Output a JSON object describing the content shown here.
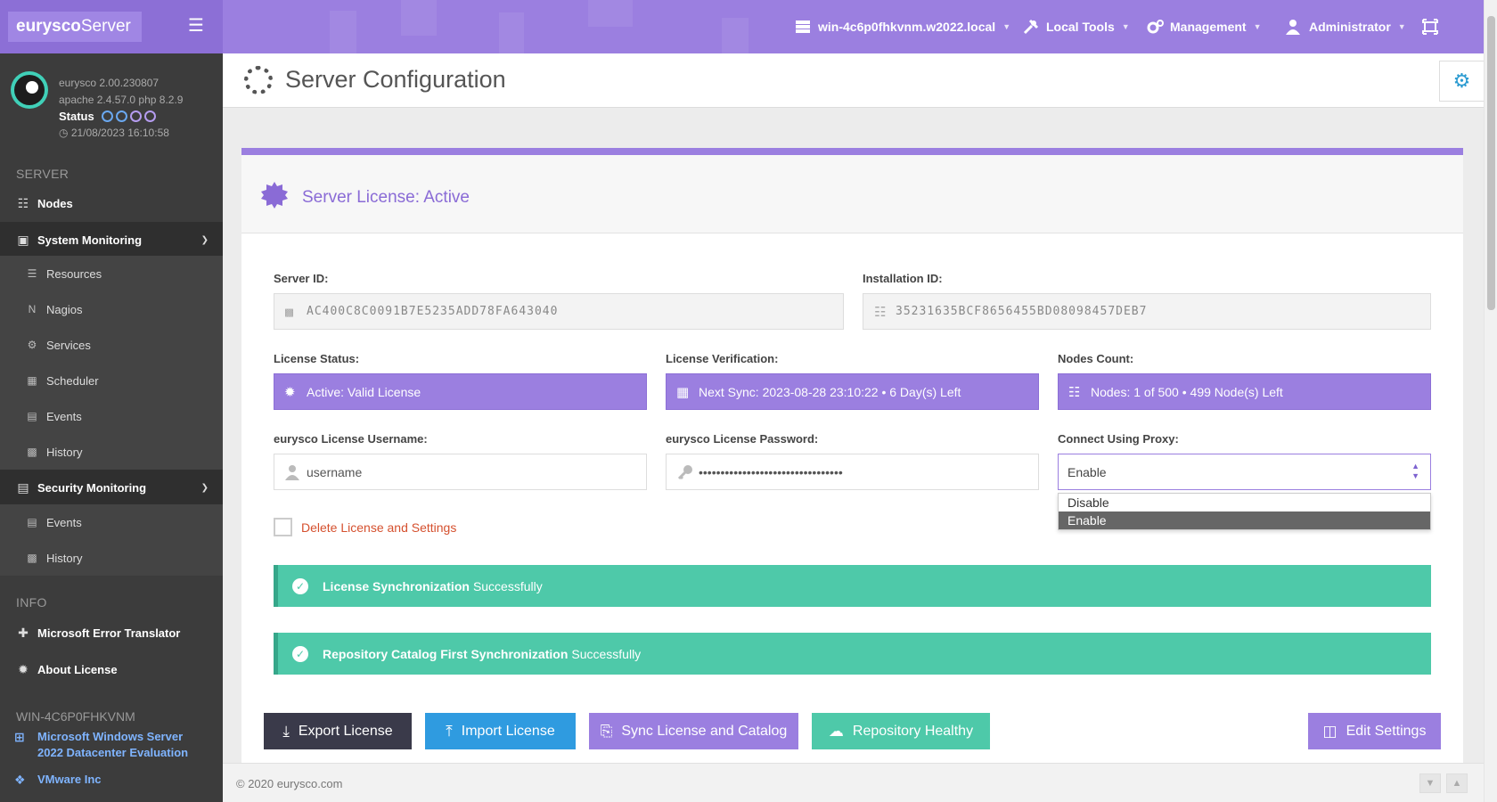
{
  "header": {
    "brand_bold": "eurysco",
    "brand_light": "Server",
    "host": "win-4c6p0fhkvnm.w2022.local",
    "local_tools": "Local Tools",
    "management": "Management",
    "user": "Administrator"
  },
  "sidebar": {
    "version": "eurysco 2.00.230807",
    "stack": "apache 2.4.57.0  php 8.2.9",
    "status_label": "Status",
    "datetime": "21/08/2023 16:10:58",
    "section_server": "SERVER",
    "nodes": "Nodes",
    "system_monitoring": "System Monitoring",
    "sys_items": [
      "Resources",
      "Nagios",
      "Services",
      "Scheduler",
      "Events",
      "History"
    ],
    "security_monitoring": "Security Monitoring",
    "sec_items": [
      "Events",
      "History"
    ],
    "section_info": "INFO",
    "error_translator": "Microsoft Error Translator",
    "about_license": "About License",
    "hostname": "WIN-4C6P0FHKVNM",
    "os": "Microsoft  Windows  Server 2022  Datacenter  Evaluation",
    "vendor": "VMware Inc"
  },
  "page": {
    "title": "Server Configuration"
  },
  "card": {
    "title": "Server License: Active",
    "server_id_label": "Server ID:",
    "server_id": "AC400C8C0091B7E5235ADD78FA643040",
    "installation_id_label": "Installation ID:",
    "installation_id": "35231635BCF8656455BD08098457DEB7",
    "license_status_label": "License Status:",
    "license_status": "Active: Valid License",
    "license_verification_label": "License Verification:",
    "license_verification": "Next Sync: 2023-08-28 23:10:22 • 6 Day(s) Left",
    "nodes_count_label": "Nodes Count:",
    "nodes_count": "Nodes: 1 of 500 • 499 Node(s) Left",
    "username_label": "eurysco License Username:",
    "username": "username",
    "password_label": "eurysco License Password:",
    "password": "•••••••••••••••••••••••••••••••••",
    "proxy_label": "Connect Using Proxy:",
    "proxy_value": "Enable",
    "proxy_options": [
      "Disable",
      "Enable"
    ],
    "delete_label": "Delete License and Settings",
    "alert1_bold": "License Synchronization",
    "alert1_rest": "Successfully",
    "alert2_bold": "Repository Catalog First Synchronization",
    "alert2_rest": "Successfully"
  },
  "buttons": {
    "export": "Export License",
    "import": "Import License",
    "sync": "Sync License and Catalog",
    "healthy": "Repository Healthy",
    "edit": "Edit Settings"
  },
  "footer": {
    "text": "© 2020   eurysco.com"
  },
  "colors": {
    "accent": "#9b7fe0",
    "sidebar": "#3c3c3c",
    "success": "#4ec9a9",
    "export_btn": "#3a3a4a",
    "import_btn": "#2f9be0",
    "danger_text": "#d5502e"
  }
}
